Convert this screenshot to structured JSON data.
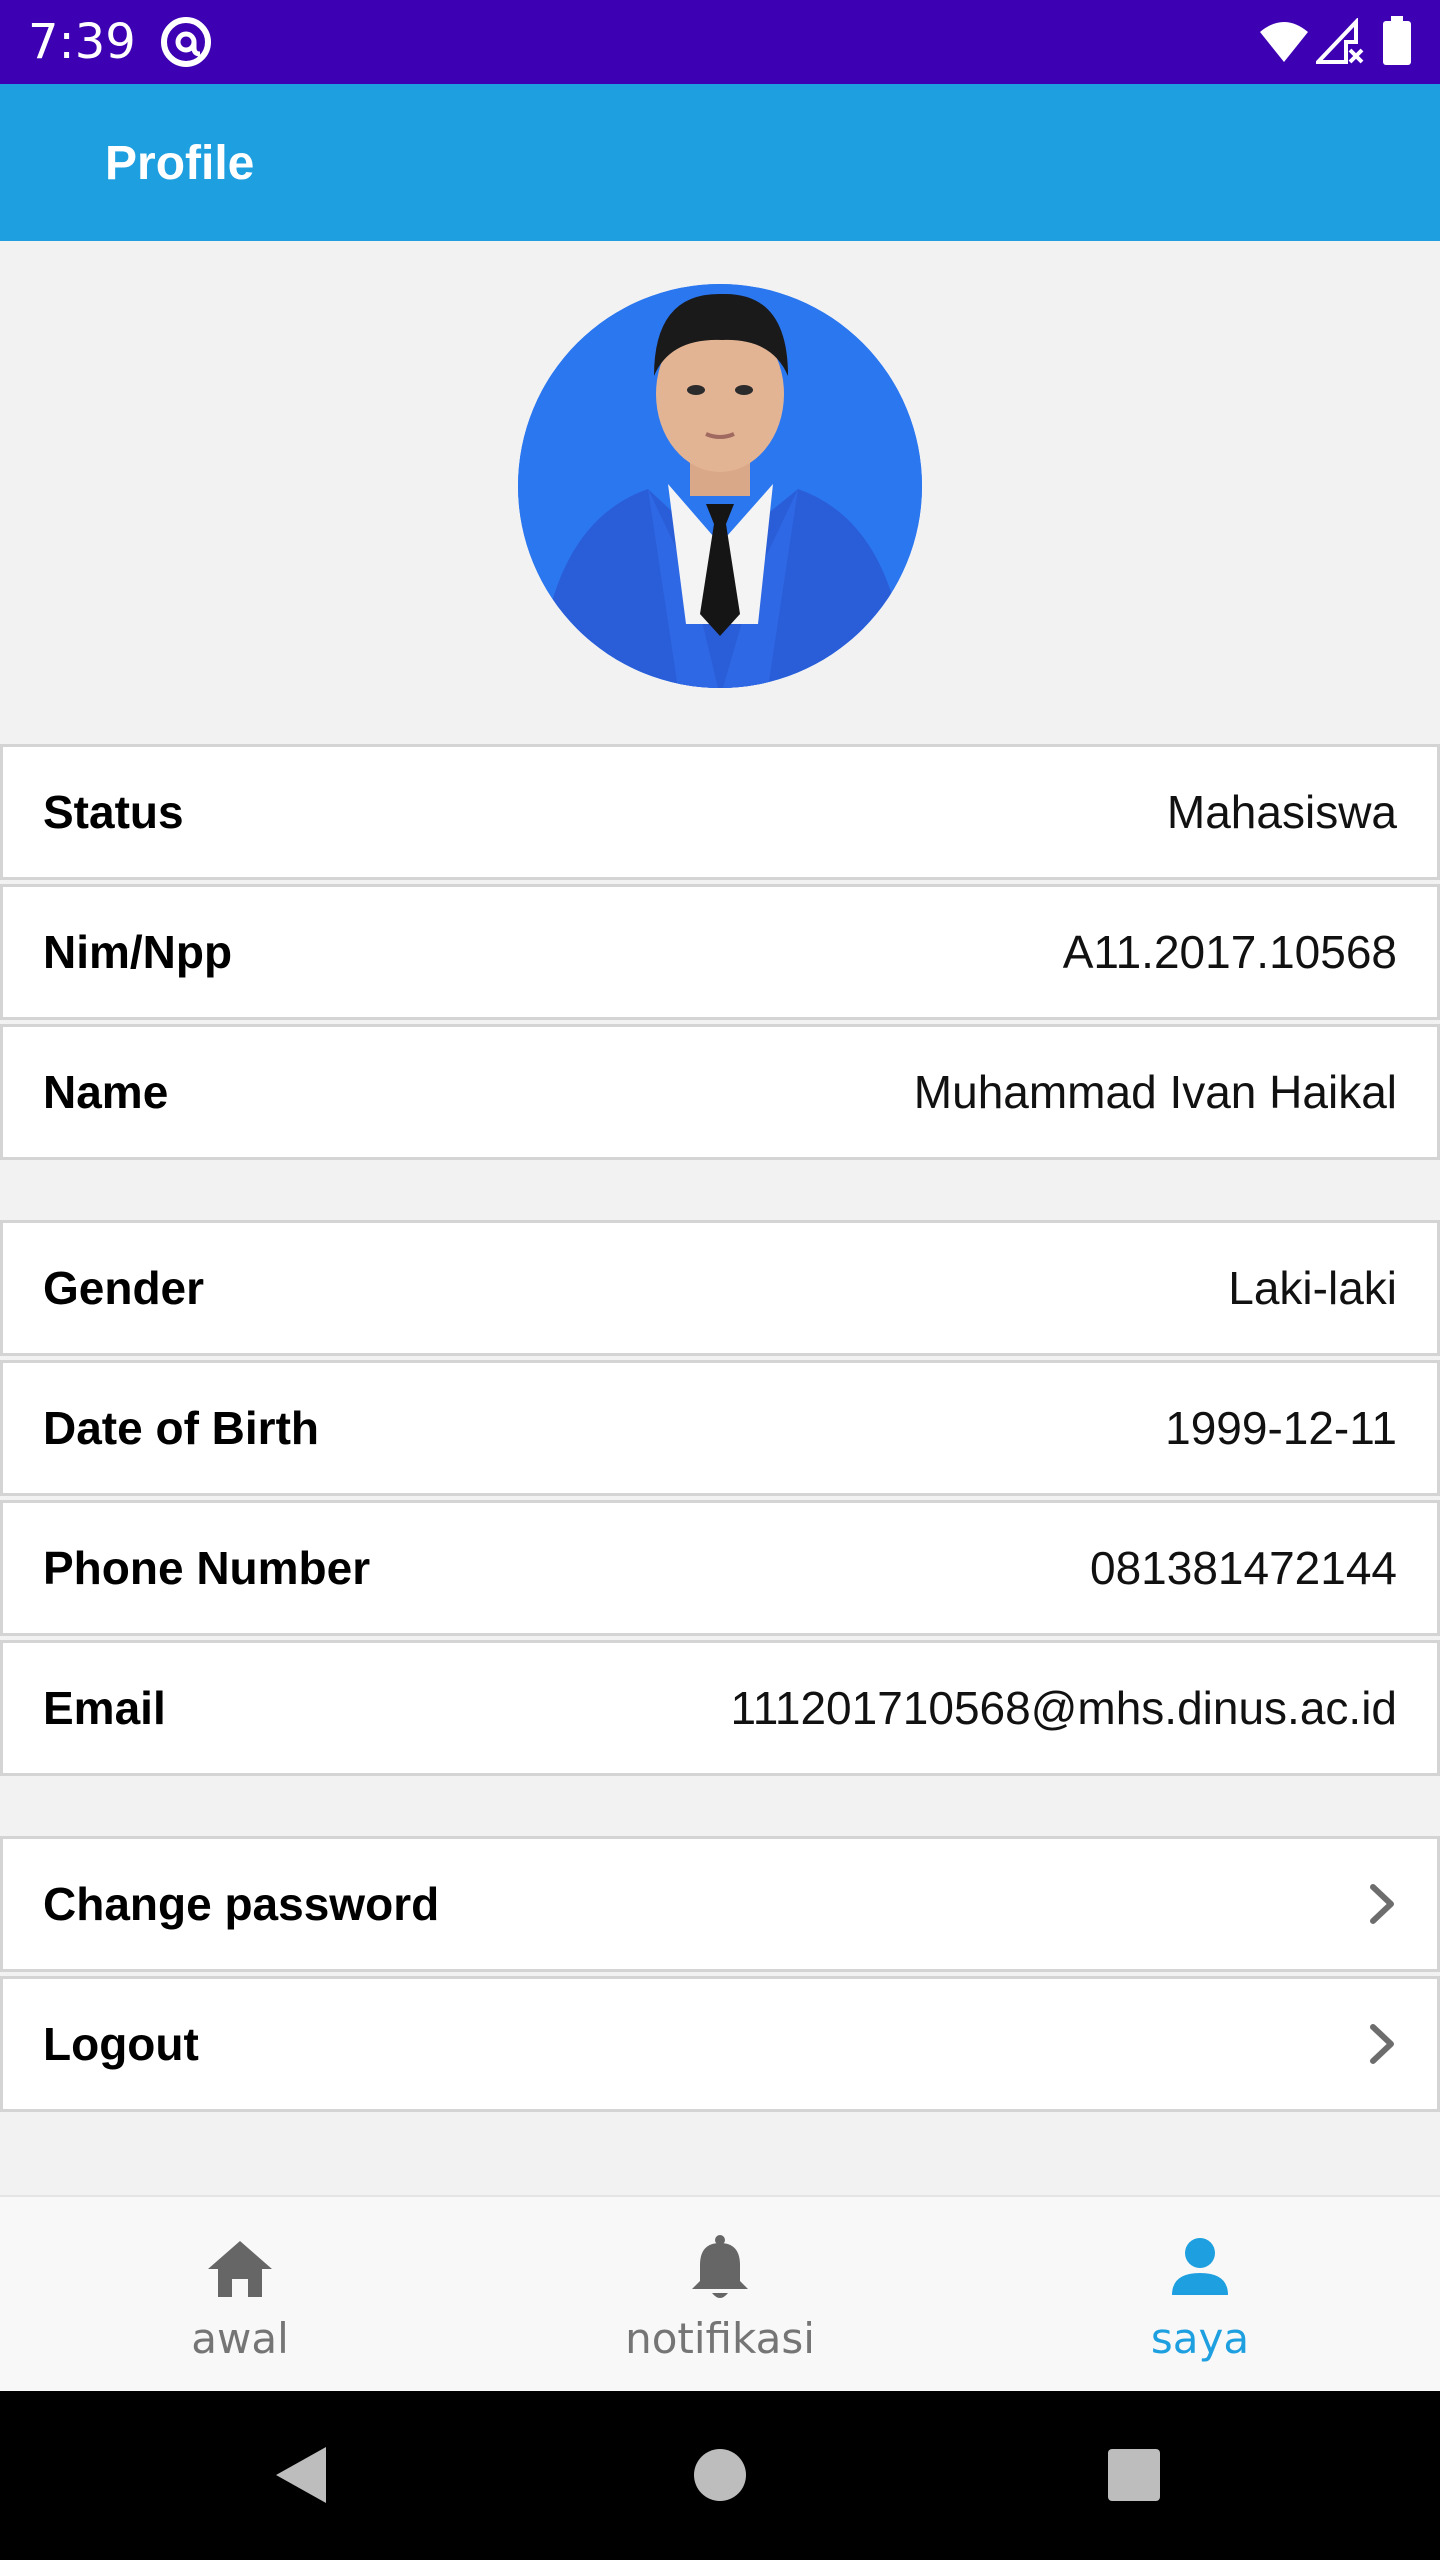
{
  "status_bar": {
    "time": "7:39"
  },
  "app_bar": {
    "title": "Profile"
  },
  "profile": {
    "avatar_icon": "profile-photo"
  },
  "identity_rows": [
    {
      "label": "Status",
      "value": "Mahasiswa"
    },
    {
      "label": "Nim/Npp",
      "value": "A11.2017.10568"
    },
    {
      "label": "Name",
      "value": "Muhammad Ivan Haikal"
    }
  ],
  "personal_rows": [
    {
      "label": "Gender",
      "value": "Laki-laki"
    },
    {
      "label": "Date of Birth",
      "value": "1999-12-11"
    },
    {
      "label": "Phone Number",
      "value": "081381472144"
    },
    {
      "label": "Email",
      "value": "111201710568@mhs.dinus.ac.id"
    }
  ],
  "action_rows": [
    {
      "label": "Change password",
      "icon": "chevron-right-icon"
    },
    {
      "label": "Logout",
      "icon": "chevron-right-icon"
    }
  ],
  "bottom_nav": {
    "items": [
      {
        "label": "awal",
        "icon": "home-icon",
        "active": false
      },
      {
        "label": "notifikasi",
        "icon": "bell-icon",
        "active": false
      },
      {
        "label": "saya",
        "icon": "person-icon",
        "active": true
      }
    ]
  },
  "colors": {
    "status_bar": "#3d00b3",
    "app_bar": "#1e9fe0",
    "active_nav": "#1e9fe0",
    "inactive_nav": "#757575"
  }
}
